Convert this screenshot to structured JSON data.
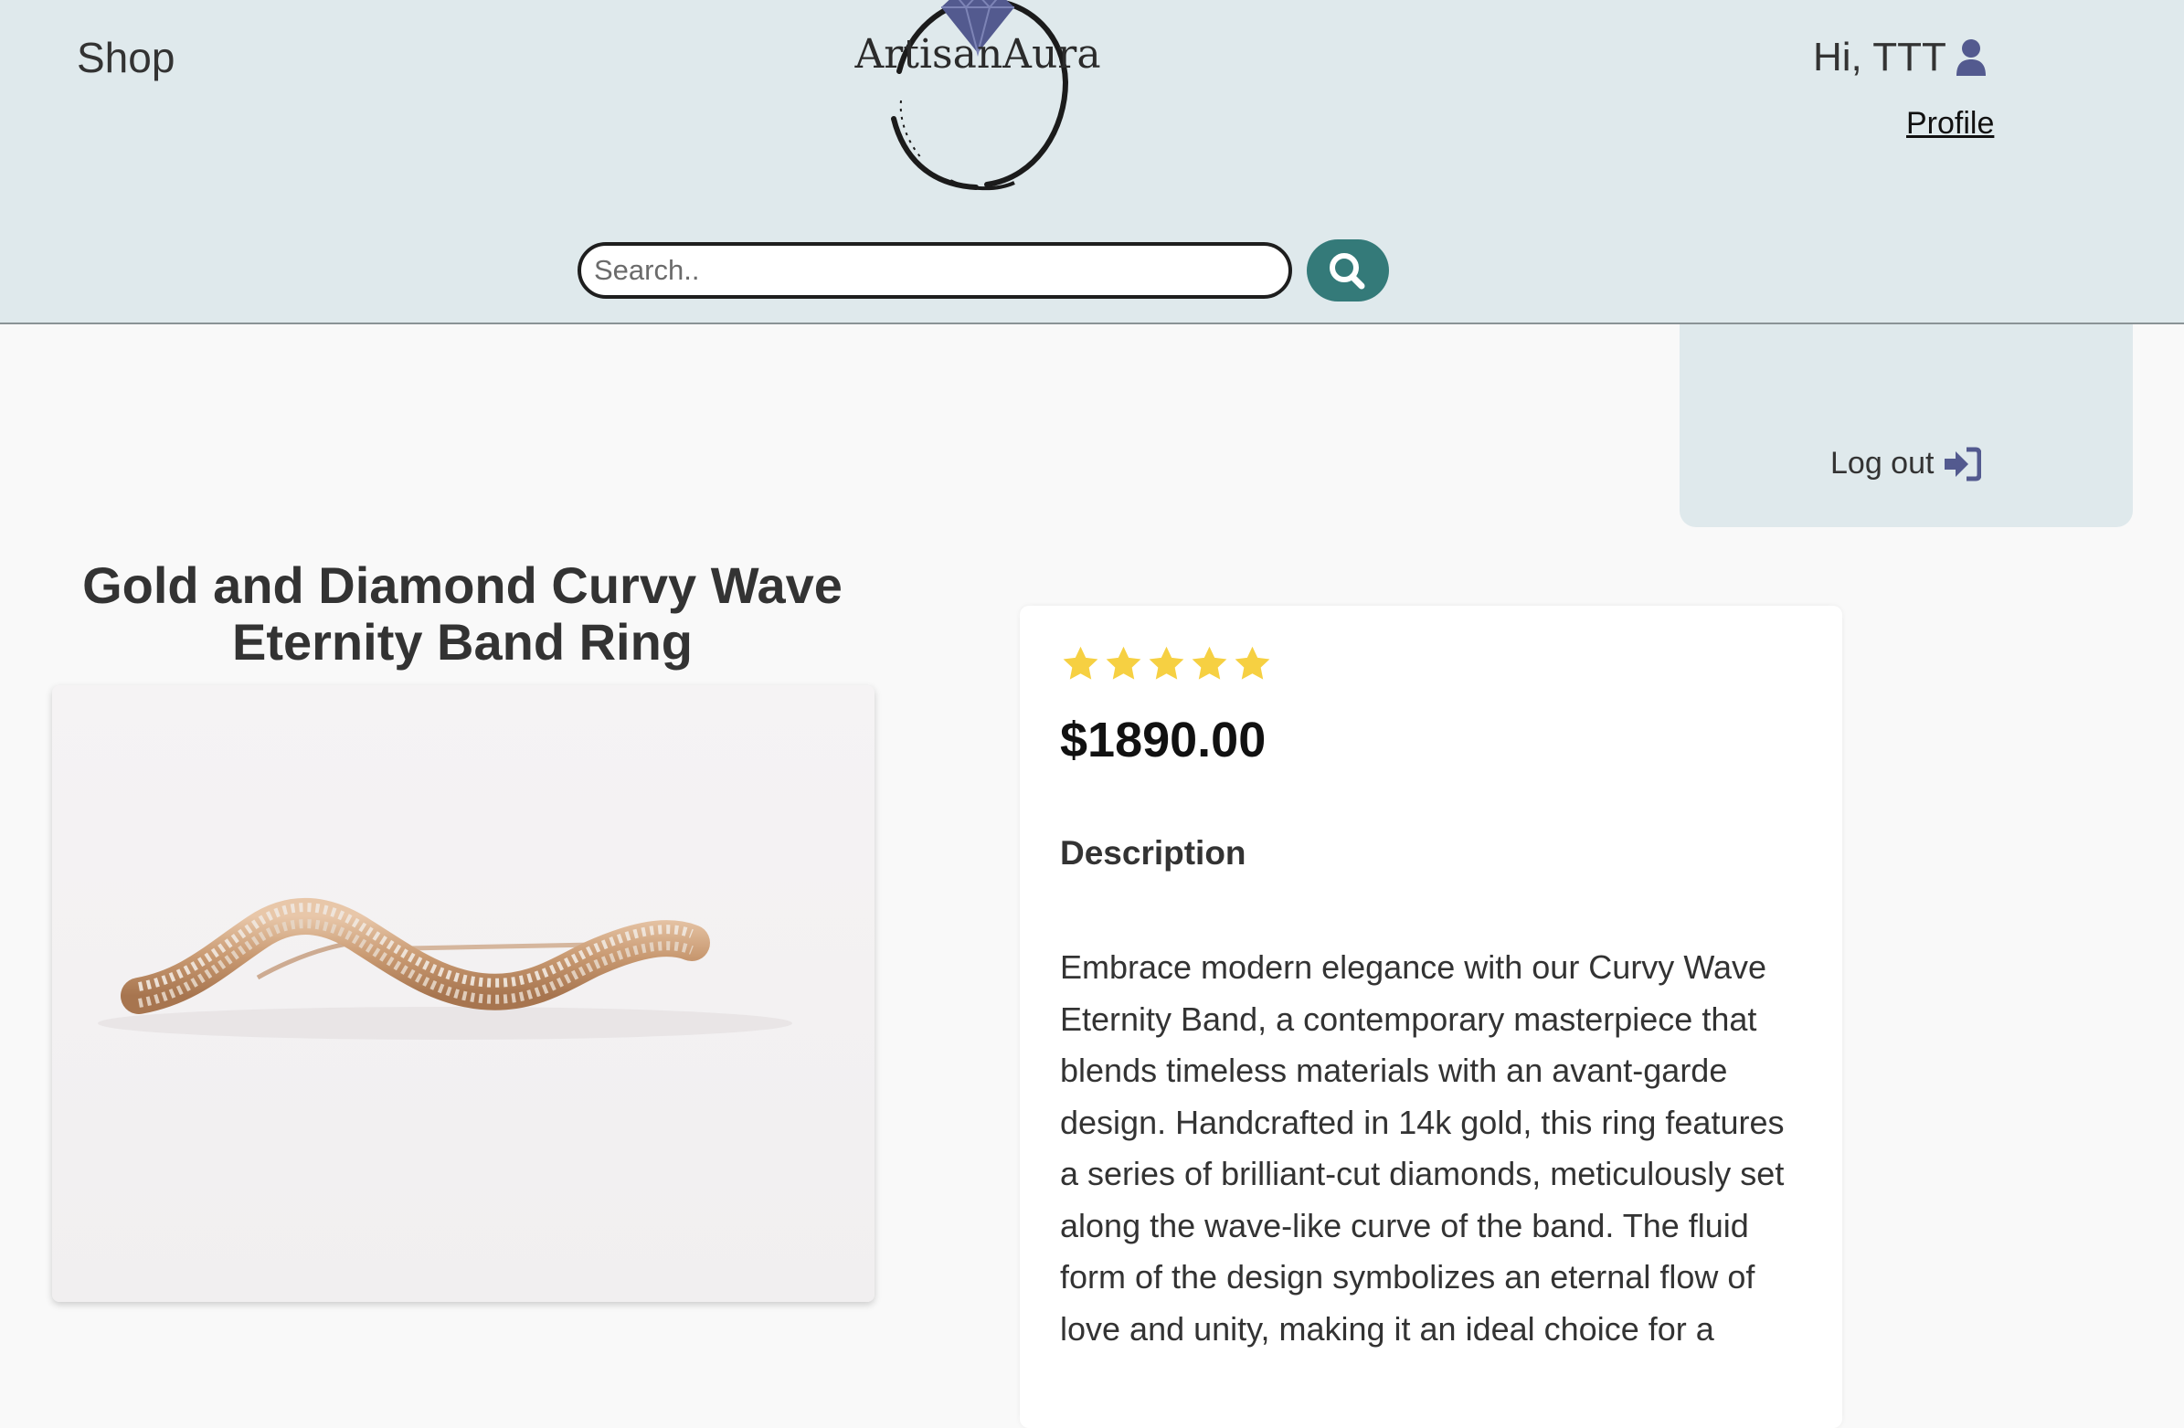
{
  "header": {
    "shop_label": "Shop",
    "logo_text": "ArtisanAura",
    "search": {
      "placeholder": "Search.."
    },
    "greeting": "Hi, TTT",
    "profile_label": "Profile",
    "logout_label": "Log out"
  },
  "product": {
    "title": "Gold and Diamond Curvy Wave Eternity Band Ring",
    "rating": 5,
    "rating_max": 5,
    "price": "$1890.00",
    "description_heading": "Description",
    "description": "Embrace modern elegance with our Curvy Wave Eternity Band, a contemporary masterpiece that blends timeless materials with an avant-garde design. Handcrafted in 14k gold, this ring features a series of brilliant-cut diamonds, meticulously set along the wave-like curve of the band. The fluid form of the design symbolizes an eternal flow of love and unity, making it an ideal choice for a"
  },
  "icons": {
    "logo": "diamond-icon",
    "search": "search-icon",
    "user": "user-icon",
    "logout": "sign-in-arrow-icon",
    "star": "star-icon"
  },
  "colors": {
    "header_bg": "#dfe9ec",
    "accent": "#347a79",
    "icon": "#535a8f",
    "star": "#f6d042",
    "page_bg": "#f9f9f9"
  }
}
